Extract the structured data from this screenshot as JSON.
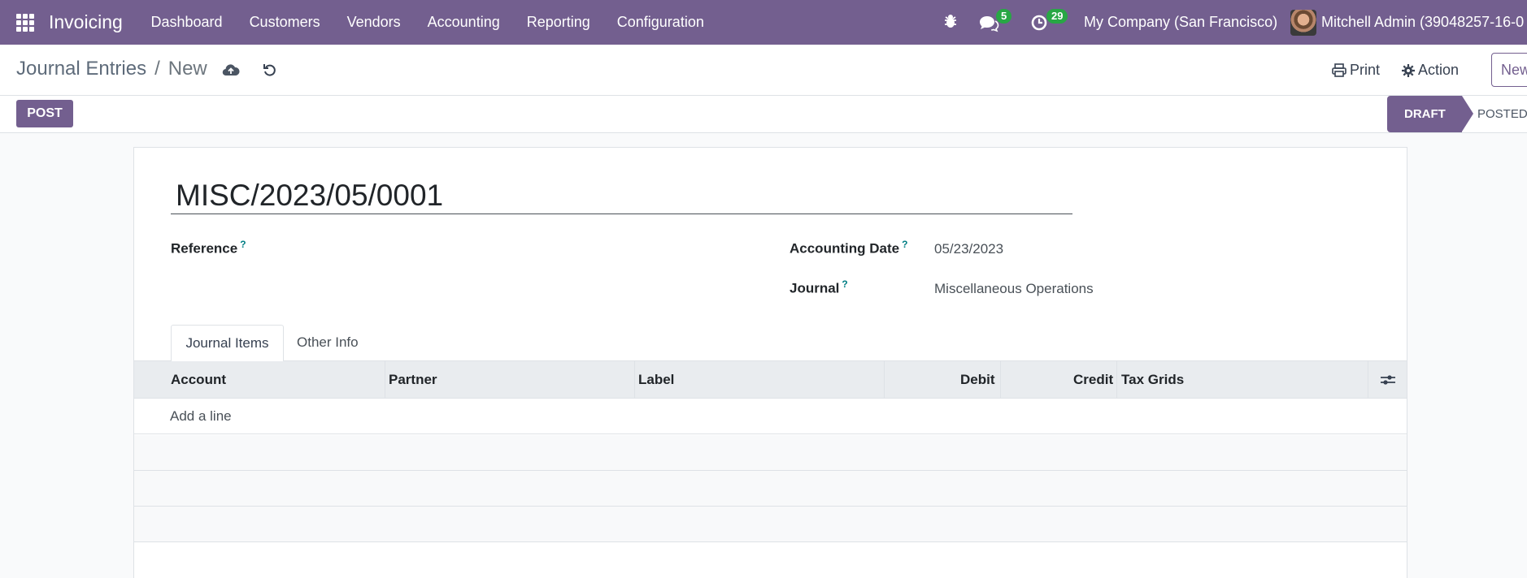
{
  "navbar": {
    "app_name": "Invoicing",
    "menu": [
      "Dashboard",
      "Customers",
      "Vendors",
      "Accounting",
      "Reporting",
      "Configuration"
    ],
    "messages_count": "5",
    "activities_count": "29",
    "company": "My Company (San Francisco)",
    "user": "Mitchell Admin (39048257-16-0"
  },
  "control_panel": {
    "breadcrumb_parent": "Journal Entries",
    "breadcrumb_separator": "/",
    "breadcrumb_current": "New",
    "print_label": "Print",
    "action_label": "Action",
    "new_label": "New"
  },
  "statusbar": {
    "post_label": "POST",
    "stages": [
      "DRAFT",
      "POSTED"
    ],
    "active_stage": "DRAFT"
  },
  "form": {
    "entry_name": "MISC/2023/05/0001",
    "reference_label": "Reference",
    "reference_value": "",
    "accounting_date_label": "Accounting Date",
    "accounting_date_value": "05/23/2023",
    "journal_label": "Journal",
    "journal_value": "Miscellaneous Operations",
    "help_marker": "?"
  },
  "tabs": [
    "Journal Items",
    "Other Info"
  ],
  "table": {
    "columns": [
      "Account",
      "Partner",
      "Label",
      "Debit",
      "Credit",
      "Tax Grids"
    ],
    "add_line_label": "Add a line"
  },
  "colors": {
    "brand": "#735f8f",
    "badge": "#28a745",
    "help": "#017e84"
  }
}
